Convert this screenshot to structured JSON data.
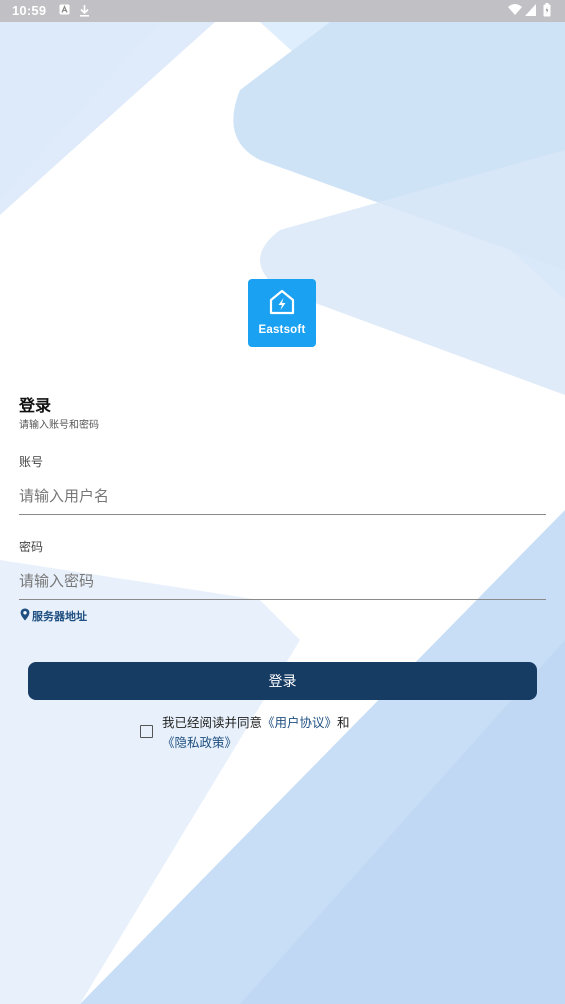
{
  "status_bar": {
    "time": "10:59",
    "left_icons": [
      "a-notification-icon",
      "download-icon"
    ],
    "right_icons": [
      "wifi-icon",
      "signal-icon",
      "battery-icon"
    ]
  },
  "logo": {
    "text": "Eastsoft",
    "icon": "house-lightning-icon",
    "color": "#1aa1f2"
  },
  "login": {
    "title": "登录",
    "subtitle": "请输入账号和密码"
  },
  "account": {
    "label": "账号",
    "placeholder": "请输入用户名",
    "value": ""
  },
  "password": {
    "label": "密码",
    "placeholder": "请输入密码",
    "value": ""
  },
  "server": {
    "icon": "location-pin-icon",
    "label": "服务器地址"
  },
  "login_button": {
    "label": "登录",
    "color": "#173c64"
  },
  "agreement": {
    "checked": false,
    "prefix": "我已经阅读并同意",
    "user_agreement": "《用户协议》",
    "and": "和",
    "privacy_policy": "《隐私政策》"
  },
  "colors": {
    "link": "#1f4f80",
    "background_accent": "#cfe3f7"
  }
}
